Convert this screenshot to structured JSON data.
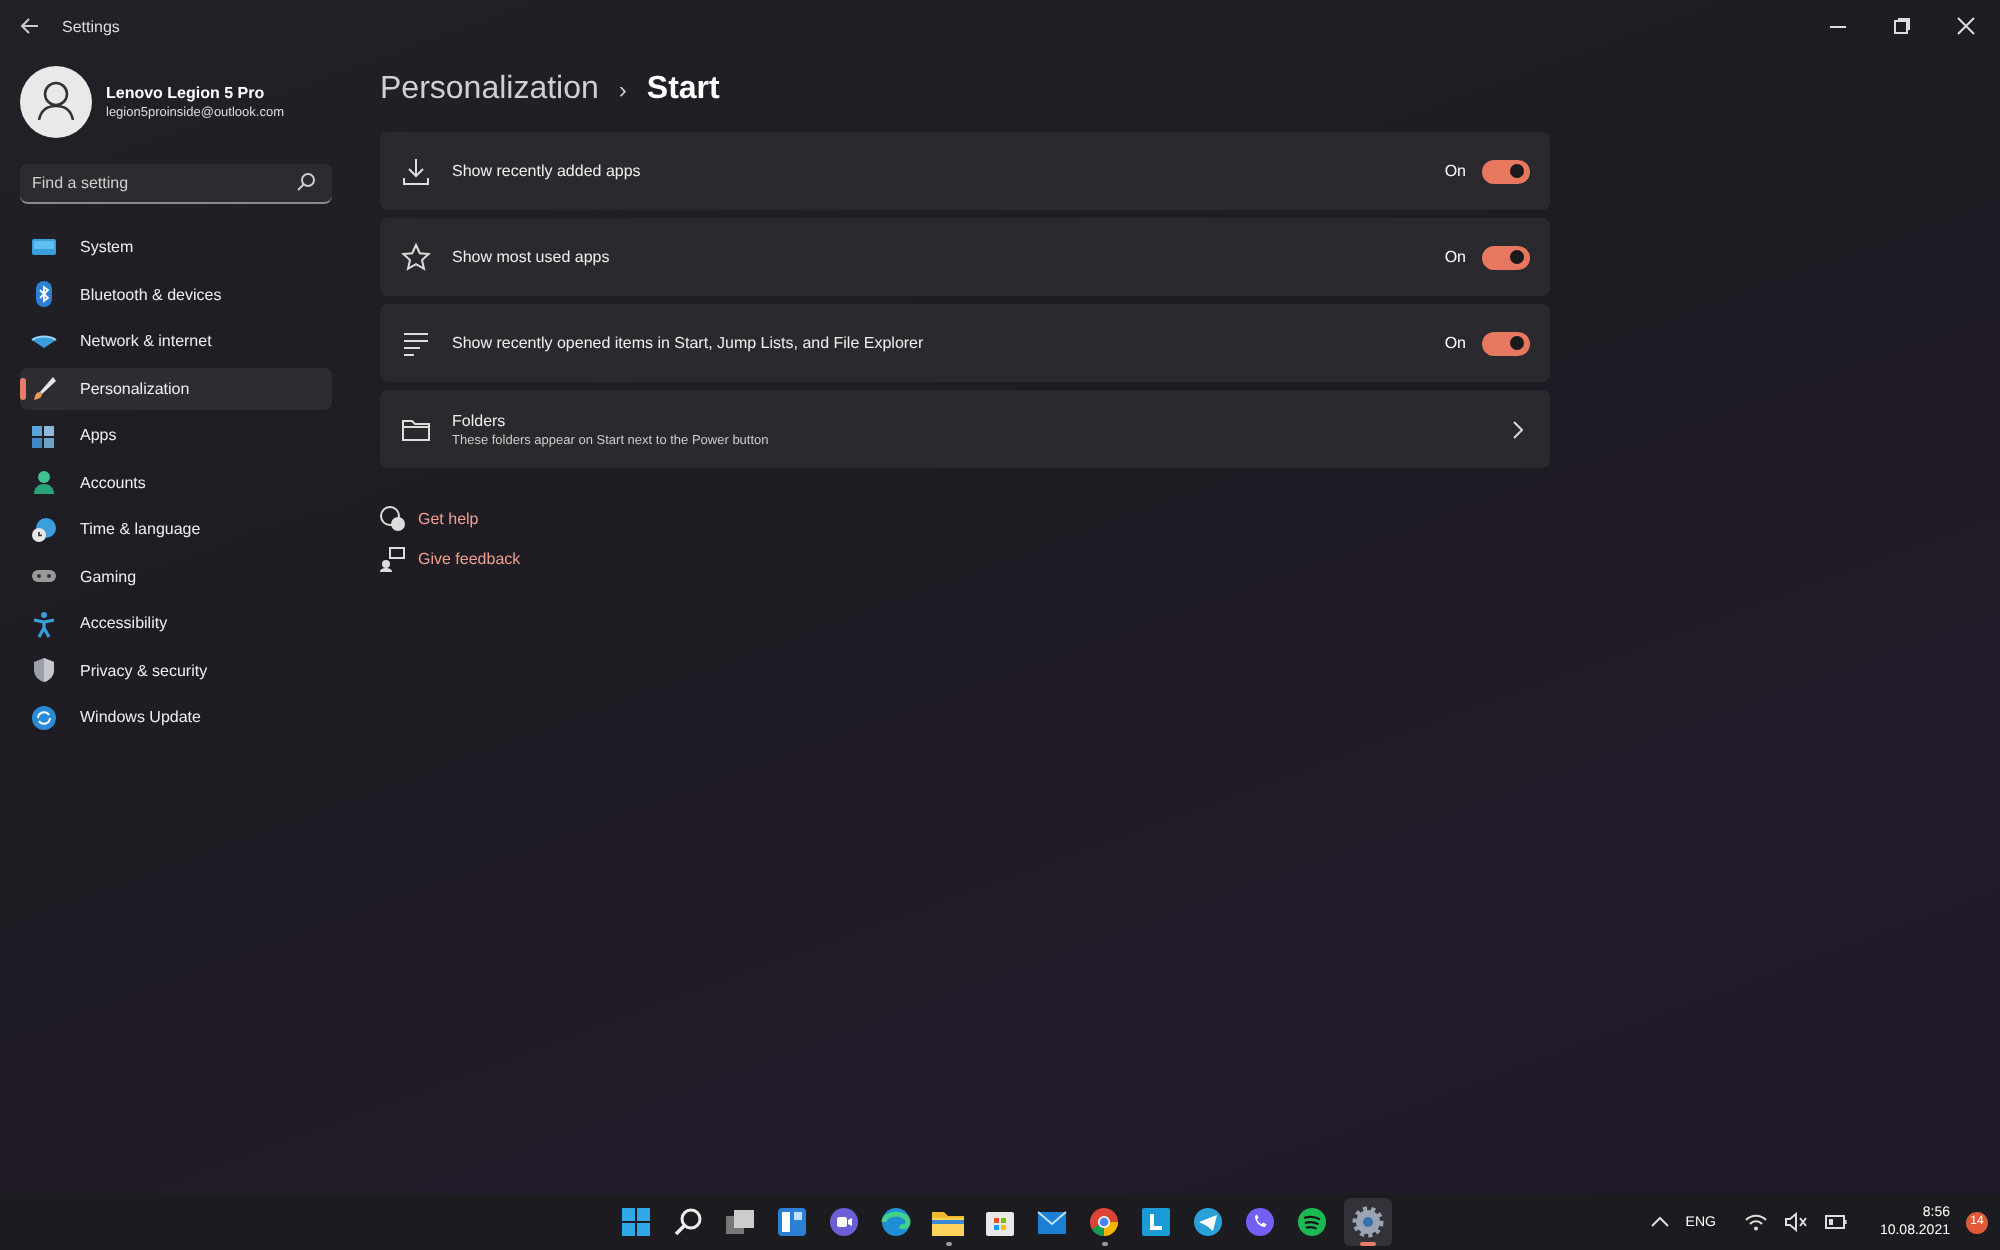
{
  "window": {
    "title": "Settings"
  },
  "profile": {
    "name": "Lenovo Legion 5 Pro",
    "email": "legion5proinside@outlook.com"
  },
  "search": {
    "placeholder": "Find a setting"
  },
  "sidebar": {
    "items": [
      {
        "label": "System",
        "kind": "system",
        "selected": false
      },
      {
        "label": "Bluetooth & devices",
        "kind": "bluetooth",
        "selected": false
      },
      {
        "label": "Network & internet",
        "kind": "network",
        "selected": false
      },
      {
        "label": "Personalization",
        "kind": "brush",
        "selected": true
      },
      {
        "label": "Apps",
        "kind": "apps",
        "selected": false
      },
      {
        "label": "Accounts",
        "kind": "accounts",
        "selected": false
      },
      {
        "label": "Time & language",
        "kind": "time",
        "selected": false
      },
      {
        "label": "Gaming",
        "kind": "gaming",
        "selected": false
      },
      {
        "label": "Accessibility",
        "kind": "accessibility",
        "selected": false
      },
      {
        "label": "Privacy & security",
        "kind": "privacy",
        "selected": false
      },
      {
        "label": "Windows Update",
        "kind": "update",
        "selected": false
      }
    ]
  },
  "breadcrumb": {
    "parent": "Personalization",
    "separator": "›",
    "current": "Start"
  },
  "settings": [
    {
      "kind": "download",
      "label": "Show recently added apps",
      "state_text": "On",
      "on": true
    },
    {
      "kind": "star",
      "label": "Show most used apps",
      "state_text": "On",
      "on": true
    },
    {
      "kind": "list",
      "label": "Show recently opened items in Start, Jump Lists, and File Explorer",
      "state_text": "On",
      "on": true
    },
    {
      "kind": "folder",
      "label": "Folders",
      "description": "These folders appear on Start next to the Power button"
    }
  ],
  "links": [
    {
      "kind": "help",
      "label": "Get help"
    },
    {
      "kind": "feedback",
      "label": "Give feedback"
    }
  ],
  "taskbar": {
    "apps": [
      {
        "kind": "start",
        "running": false
      },
      {
        "kind": "search",
        "running": false
      },
      {
        "kind": "taskview",
        "running": false
      },
      {
        "kind": "widgets",
        "running": false
      },
      {
        "kind": "chat",
        "running": false
      },
      {
        "kind": "edge",
        "running": false
      },
      {
        "kind": "explorer",
        "running": true
      },
      {
        "kind": "store",
        "running": false
      },
      {
        "kind": "mail",
        "running": false
      },
      {
        "kind": "chrome",
        "running": true
      },
      {
        "kind": "lapp",
        "running": false
      },
      {
        "kind": "telegram",
        "running": false
      },
      {
        "kind": "viber",
        "running": false
      },
      {
        "kind": "spotify",
        "running": false
      },
      {
        "kind": "settings",
        "running": true,
        "selected": true
      }
    ],
    "language": "ENG",
    "time": "8:56",
    "date": "10.08.2021",
    "notifications": "14"
  }
}
